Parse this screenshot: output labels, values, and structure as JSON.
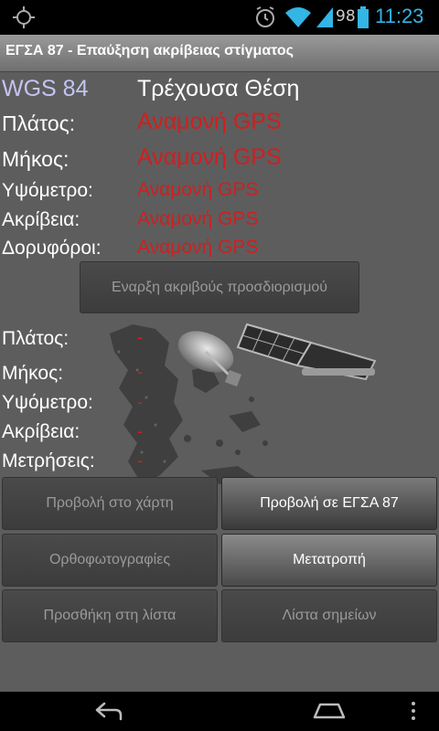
{
  "status_bar": {
    "battery_level": "98",
    "clock": "11:23",
    "icons": [
      "gps-icon",
      "alarm-icon",
      "wifi-icon",
      "signal-icon",
      "battery-icon"
    ]
  },
  "title_bar": {
    "title": "ΕΓΣΑ 87 - Επαύξηση ακρίβειας στίγματος"
  },
  "current": {
    "datum": "WGS 84",
    "heading": "Τρέχουσα Θέση",
    "rows": [
      {
        "label": "Πλάτος:",
        "value": "Αναμονή GPS"
      },
      {
        "label": "Μήκος:",
        "value": "Αναμονή GPS"
      },
      {
        "label": "Υψόμετρο:",
        "value": "Αναμονή GPS"
      },
      {
        "label": "Ακρίβεια:",
        "value": "Αναμονή GPS"
      },
      {
        "label": "Δορυφόροι:",
        "value": "Αναμονή GPS"
      }
    ]
  },
  "start_button": {
    "label": "Εναρξη ακριβούς προσδιορισμού"
  },
  "precise": {
    "rows": [
      {
        "label": "Πλάτος:",
        "value": "-"
      },
      {
        "label": "Μήκος:",
        "value": "-"
      },
      {
        "label": "Υψόμετρο:",
        "value": "-"
      },
      {
        "label": "Ακρίβεια:",
        "value": "-"
      },
      {
        "label": "Μετρήσεις:",
        "value": "-"
      }
    ]
  },
  "buttons": {
    "view_map": "Προβολή στο χάρτη",
    "view_egsa": "Προβολή σε ΕΓΣΑ 87",
    "orthophotos": "Ορθοφωτογραφίες",
    "convert": "Μετατροπή",
    "add_to_list": "Προσθήκη στη λίστα",
    "point_list": "Λίστα σημείων"
  },
  "colors": {
    "accent_blue": "#33b5e5",
    "waiting_red": "#d01f1f",
    "datum_label": "#c4c4f2",
    "background": "#5d5d5d"
  }
}
